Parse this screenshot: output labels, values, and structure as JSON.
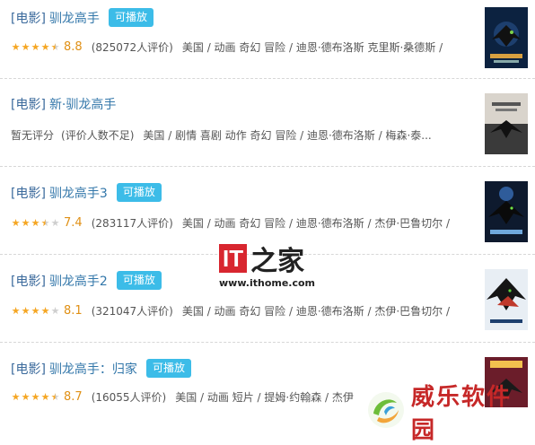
{
  "results": [
    {
      "type": "[电影]",
      "title": "驯龙高手",
      "play": "可播放",
      "stars": [
        1,
        1,
        1,
        1,
        0.5
      ],
      "rating": "8.8",
      "count": "(825072人评价)",
      "meta": "美国 / 动画 奇幻 冒险 / 迪恩·德布洛斯 克里斯·桑德斯 /"
    },
    {
      "type": "[电影]",
      "title": "新·驯龙高手",
      "play": "",
      "noscore": "暂无评分",
      "count": "(评价人数不足)",
      "meta": "美国 / 剧情 喜剧 动作 奇幻 冒险 / 迪恩·德布洛斯 / 梅森·泰..."
    },
    {
      "type": "[电影]",
      "title": "驯龙高手3",
      "play": "可播放",
      "stars": [
        1,
        1,
        1,
        0.5,
        0
      ],
      "rating": "7.4",
      "count": "(283117人评价)",
      "meta": "美国 / 动画 奇幻 冒险 / 迪恩·德布洛斯 / 杰伊·巴鲁切尔 /"
    },
    {
      "type": "[电影]",
      "title": "驯龙高手2",
      "play": "可播放",
      "stars": [
        1,
        1,
        1,
        1,
        0
      ],
      "rating": "8.1",
      "count": "(321047人评价)",
      "meta": "美国 / 动画 奇幻 冒险 / 迪恩·德布洛斯 / 杰伊·巴鲁切尔 /"
    },
    {
      "type": "[电影]",
      "title": "驯龙高手：归家",
      "play": "可播放",
      "stars": [
        1,
        1,
        1,
        1,
        0.5
      ],
      "rating": "8.7",
      "count": "(16055人评价)",
      "meta": "美国 / 动画 短片 / 提姆·约翰森 / 杰伊"
    }
  ],
  "watermark": {
    "it_box": "IT",
    "it_zh": "之家",
    "url": "www.ithome.com",
    "logo_text": "威乐软件园"
  },
  "colors": {
    "link": "#3377aa",
    "play": "#3cbce8",
    "star": "#f5a623",
    "rating": "#e09015"
  }
}
